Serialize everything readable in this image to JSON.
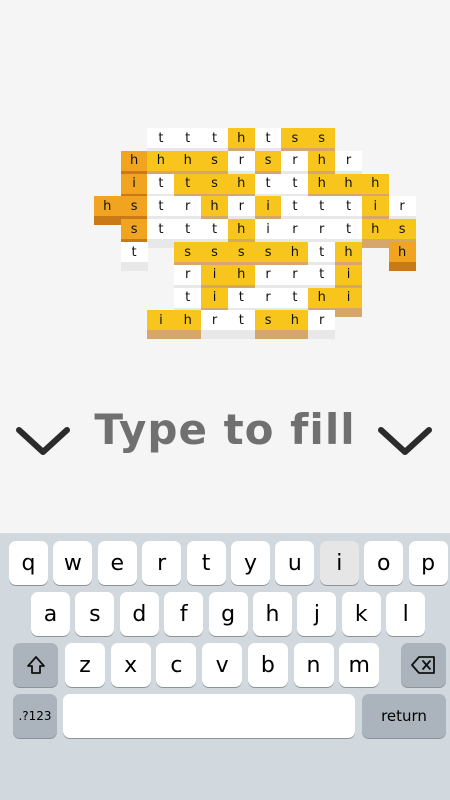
{
  "prompt": "Type to fill",
  "colors": {
    "yellow": "#f7c51b",
    "orange": "#f0a420",
    "deep_orange": "#e8861a",
    "white": "#ffffff",
    "tan": "#d7a66a",
    "page_background": "#f5f5f5",
    "keyboard_background": "#d1d8de"
  },
  "board": {
    "rows": [
      [
        null,
        null,
        null,
        "W:t",
        "W:t",
        "W:t",
        "Y:h",
        "W:t",
        "Y:s",
        "Y:s",
        null,
        null,
        null,
        null
      ],
      [
        null,
        null,
        "O:h",
        "Y:h",
        "Y:h",
        "Y:s",
        "W:r",
        "Y:s",
        "W:r",
        "Y:h",
        "W:r",
        null,
        null,
        null
      ],
      [
        null,
        null,
        "O:i",
        "W:t",
        "Y:t",
        "Y:s",
        "Y:h",
        "W:t",
        "W:t",
        "Y:h",
        "Y:h",
        "Y:h",
        null,
        null
      ],
      [
        null,
        "O:h",
        "O:s",
        "W:t",
        "W:r",
        "Y:h",
        "W:r",
        "Y:i",
        "W:t",
        "W:t",
        "W:t",
        "Y:i",
        "W:r",
        null
      ],
      [
        null,
        null,
        "O:s",
        "W:t",
        "W:t",
        "W:t",
        "Y:h",
        "W:i",
        "W:r",
        "W:r",
        "W:t",
        "Y:h",
        "Y:s",
        null
      ],
      [
        null,
        null,
        "W:t",
        null,
        "Y:s",
        "Y:s",
        "Y:s",
        "Y:s",
        "Y:h",
        "W:t",
        "Y:h",
        null,
        "O:h",
        null
      ],
      [
        null,
        null,
        null,
        null,
        "W:r",
        "Y:i",
        "Y:h",
        "W:r",
        "W:r",
        "W:t",
        "Y:i",
        null,
        null,
        null
      ],
      [
        null,
        null,
        null,
        null,
        "W:t",
        "Y:i",
        "W:t",
        "W:r",
        "W:t",
        "Y:h",
        "Y:i",
        null,
        null,
        null
      ],
      [
        null,
        null,
        null,
        "Y:i",
        "Y:h",
        "W:r",
        "W:t",
        "Y:s",
        "Y:h",
        "W:r",
        null,
        null,
        null,
        null
      ]
    ]
  },
  "keyboard": {
    "row1": [
      "q",
      "w",
      "e",
      "r",
      "t",
      "y",
      "u",
      "i",
      "o",
      "p"
    ],
    "row2": [
      "a",
      "s",
      "d",
      "f",
      "g",
      "h",
      "j",
      "k",
      "l"
    ],
    "row3": [
      "z",
      "x",
      "c",
      "v",
      "b",
      "n",
      "m"
    ],
    "shift_icon": "shift-arrow-icon",
    "backspace_icon": "backspace-icon",
    "numbers_label": ".?123",
    "space_label": "",
    "return_label": "return",
    "pressed_key": "i"
  }
}
